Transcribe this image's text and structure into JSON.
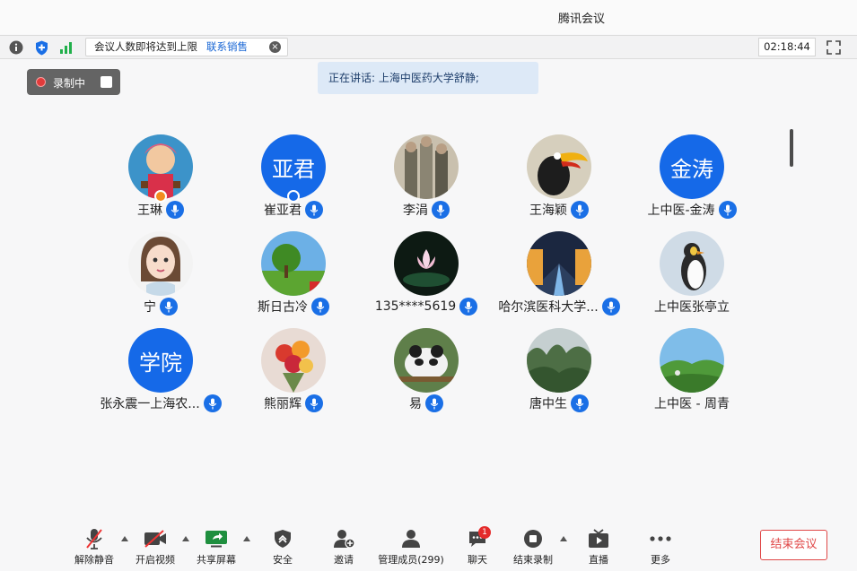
{
  "window": {
    "title": "腾讯会议"
  },
  "infobar": {
    "notice_text": "会议人数即将达到上限",
    "notice_link": "联系销售",
    "timer": "02:18:44"
  },
  "recording": {
    "label": "录制中"
  },
  "speaking": {
    "text": "正在讲话: 上海中医药大学舒静;"
  },
  "participants": [
    {
      "name": "王琳",
      "avatar_text": "",
      "avatar": "girl-photo",
      "mic": true,
      "badge": "host"
    },
    {
      "name": "崔亚君",
      "avatar_text": "亚君",
      "mic": true,
      "badge": "cohost"
    },
    {
      "name": "李涓",
      "avatar_text": "",
      "avatar": "people-photo",
      "mic": true,
      "badge": ""
    },
    {
      "name": "王海颖",
      "avatar_text": "",
      "avatar": "bird-photo",
      "mic": true,
      "badge": ""
    },
    {
      "name": "上中医-金涛",
      "avatar_text": "金涛",
      "mic": true,
      "badge": ""
    },
    {
      "name": "宁",
      "avatar_text": "",
      "avatar": "woman-photo",
      "mic": true,
      "badge": ""
    },
    {
      "name": "斯日古冷",
      "avatar_text": "",
      "avatar": "tree-photo",
      "mic": true,
      "badge": ""
    },
    {
      "name": "135****5619",
      "avatar_text": "",
      "avatar": "lotus-photo",
      "mic": true,
      "badge": ""
    },
    {
      "name": "哈尔滨医科大学...",
      "avatar_text": "",
      "avatar": "city-photo",
      "mic": true,
      "badge": ""
    },
    {
      "name": "上中医张亭立",
      "avatar_text": "",
      "avatar": "penguin-photo",
      "mic": false,
      "badge": ""
    },
    {
      "name": "张永震一上海农...",
      "avatar_text": "学院",
      "mic": true,
      "badge": ""
    },
    {
      "name": "熊丽辉",
      "avatar_text": "",
      "avatar": "flowers-photo",
      "mic": true,
      "badge": ""
    },
    {
      "name": "易",
      "avatar_text": "",
      "avatar": "panda-photo",
      "mic": true,
      "badge": ""
    },
    {
      "name": "唐中生",
      "avatar_text": "",
      "avatar": "forest-photo",
      "mic": true,
      "badge": ""
    },
    {
      "name": "上中医 - 周青",
      "avatar_text": "",
      "avatar": "landscape-photo",
      "mic": false,
      "badge": ""
    }
  ],
  "toolbar": {
    "unmute": "解除静音",
    "video": "开启视频",
    "share": "共享屏幕",
    "security": "安全",
    "invite": "邀请",
    "members": "管理成员(299)",
    "chat": "聊天",
    "chat_badge": "1",
    "stop_record": "结束录制",
    "live": "直播",
    "more": "更多",
    "end": "结束会议"
  },
  "colors": {
    "accent": "#1a6fe6",
    "danger": "#e04848",
    "avatar_blue": "#1569e8"
  }
}
